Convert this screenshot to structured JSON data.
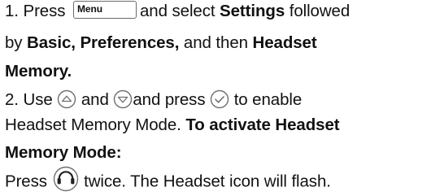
{
  "step1": {
    "prefix": "1. Press ",
    "menu_key_label": "Menu",
    "mid": "and select ",
    "settings": "Settings",
    "followed": " followed",
    "by": "by ",
    "basic": "Basic, Preferences,",
    "and_then": " and then ",
    "headset": "Headset",
    "memory": "Memory."
  },
  "step2": {
    "use": "2. Use ",
    "and": " and ",
    "and_press": "and press ",
    "to_enable": " to enable",
    "line4_normal": "Headset Memory Mode. ",
    "line4_bold": "To activate Headset",
    "line5_bold": "Memory Mode:"
  },
  "step3": {
    "press": "Press ",
    "rest": " twice. The Headset icon will flash."
  },
  "icons": {
    "up": "up-arrow-key-icon",
    "down": "down-arrow-key-icon",
    "ok": "checkmark-ok-key-icon",
    "headset": "headset-key-icon"
  }
}
